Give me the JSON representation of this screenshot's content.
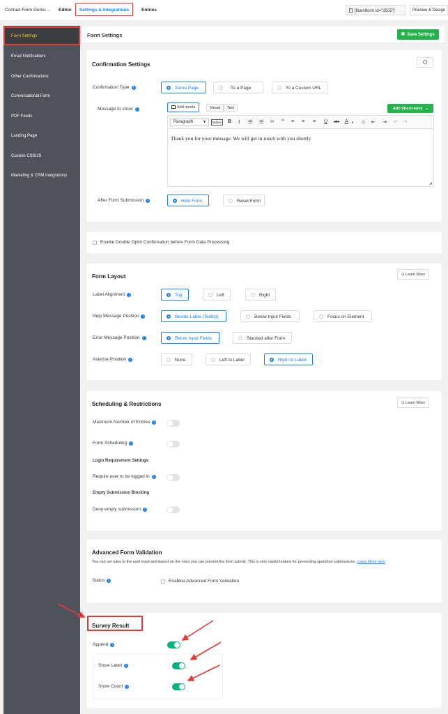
{
  "topbar": {
    "form_name": "Contact Form Demo ...",
    "editor_tab": "Editor",
    "settings_tab": "Settings & Integrations",
    "entries_tab": "Entries",
    "shortcode": "[fluentform id=\"2505\"]",
    "preview_button": "Preview & Design"
  },
  "sidebar": {
    "items": [
      {
        "label": "Form Settings"
      },
      {
        "label": "Email Notifications"
      },
      {
        "label": "Other Confirmations"
      },
      {
        "label": "Conversational Form"
      },
      {
        "label": "PDF Feeds"
      },
      {
        "label": "Landing Page"
      },
      {
        "label": "Custom CSS/JS"
      },
      {
        "label": "Marketing & CRM Integrations"
      }
    ]
  },
  "header": {
    "title": "Form Settings",
    "save_button": "Save Settings"
  },
  "confirmation": {
    "title": "Confirmation Settings",
    "type_label": "Confirmation Type",
    "type_options": [
      "Same Page",
      "To a Page",
      "To a Custom URL"
    ],
    "message_label": "Message to show",
    "add_media": "Add media",
    "visual_tab": "Visual",
    "text_tab": "Text",
    "add_shortcodes": "Add Shortcodes",
    "paragraph_select": "Paragraph",
    "button_tag": "Button",
    "message_text": "Thank you for your message. We will get in touch with you shortly",
    "after_submission_label": "After Form Submission",
    "after_options": [
      "Hide Form",
      "Reset Form"
    ]
  },
  "double_optin": {
    "label": "Enable Double Optin Confirmation before Form Data Processing"
  },
  "layout": {
    "title": "Form Layout",
    "learn_more": "Learn More",
    "label_alignment": "Label Alignment",
    "label_alignment_options": [
      "Top",
      "Left",
      "Right"
    ],
    "help_message_position": "Help Message Position",
    "help_message_options": [
      "Beside Label (Tooltip)",
      "Below Input Fields",
      "Focus on Element"
    ],
    "error_message_position": "Error Message Position",
    "error_message_options": [
      "Below Input Fields",
      "Stacked after Form"
    ],
    "asterisk_position": "Asterisk Position",
    "asterisk_options": [
      "None",
      "Left to Label",
      "Right to Label"
    ]
  },
  "scheduling": {
    "title": "Scheduling & Restrictions",
    "learn_more": "Learn More",
    "max_entries": "Maximum Number of Entries",
    "form_scheduling": "Form Scheduling",
    "login_requirement": "Login Requirement Settings",
    "require_login": "Require user to be logged in",
    "empty_blocking": "Empty Submission Blocking",
    "deny_empty": "Deny empty submission"
  },
  "validation": {
    "title": "Advanced Form Validation",
    "description": "You can set rules to the user input and based on the rules you can prevent the form submit. This is very useful feature for preventing spam/bot submissions.",
    "learn_more_link": "Learn More here",
    "status_label": "Status",
    "enable_label": "Enabled Advanced Form Validation"
  },
  "survey": {
    "title": "Survey Result",
    "append": "Append",
    "show_label": "Show Label",
    "show_count": "Show Count"
  },
  "colors": {
    "accent": "#1a7efb",
    "sidebar_bg": "#4e5259",
    "sidebar_active_text": "#fec20c",
    "save_green": "#24b24b",
    "toggle_on": "#00b27f",
    "highlight_red": "#e53935"
  }
}
